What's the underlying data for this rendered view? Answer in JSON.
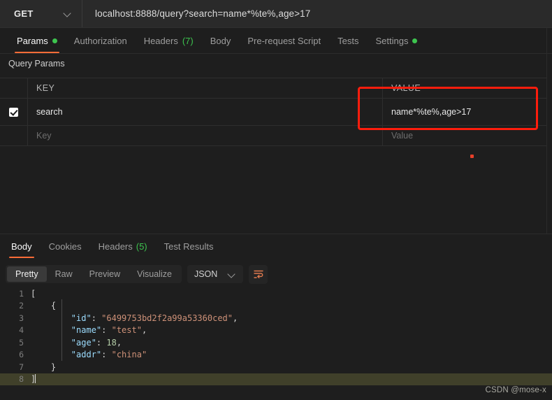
{
  "request": {
    "method": "GET",
    "method_caret_icon": "chevron-down-icon",
    "url": "localhost:8888/query?search=name*%te%,age>17"
  },
  "request_tabs": [
    {
      "label": "Params",
      "badge": "dot",
      "active": true
    },
    {
      "label": "Authorization",
      "badge": "",
      "active": false
    },
    {
      "label": "Headers",
      "badge": "(7)",
      "active": false
    },
    {
      "label": "Body",
      "badge": "",
      "active": false
    },
    {
      "label": "Pre-request Script",
      "badge": "",
      "active": false
    },
    {
      "label": "Tests",
      "badge": "",
      "active": false
    },
    {
      "label": "Settings",
      "badge": "dot",
      "active": false
    }
  ],
  "query_params": {
    "section_title": "Query Params",
    "columns": {
      "key": "KEY",
      "value": "VALUE"
    },
    "rows": [
      {
        "checked": true,
        "key": "search",
        "value": "name*%te%,age>17"
      }
    ],
    "placeholder_row": {
      "key": "Key",
      "value": "Value"
    }
  },
  "annotation": {
    "color": "#fd1d0d",
    "target": "value-cell-highlight"
  },
  "response_tabs": [
    {
      "label": "Body",
      "badge": "",
      "active": true
    },
    {
      "label": "Cookies",
      "badge": "",
      "active": false
    },
    {
      "label": "Headers",
      "badge": "(5)",
      "active": false
    },
    {
      "label": "Test Results",
      "badge": "",
      "active": false
    }
  ],
  "view_bar": {
    "segments": [
      {
        "label": "Pretty",
        "active": true
      },
      {
        "label": "Raw",
        "active": false
      },
      {
        "label": "Preview",
        "active": false
      },
      {
        "label": "Visualize",
        "active": false
      }
    ],
    "format": "JSON",
    "format_caret_icon": "chevron-down-icon",
    "wrap_icon": "word-wrap-icon"
  },
  "response_body": {
    "lines": [
      {
        "num": "1",
        "segments": [
          {
            "t": "[",
            "c": "punct"
          }
        ],
        "highlight": false,
        "caret": false
      },
      {
        "num": "2",
        "segments": [
          {
            "t": "    {",
            "c": "punct"
          }
        ],
        "highlight": false,
        "caret": false
      },
      {
        "num": "3",
        "segments": [
          {
            "t": "        ",
            "c": "punct"
          },
          {
            "t": "\"id\"",
            "c": "key"
          },
          {
            "t": ": ",
            "c": "punct"
          },
          {
            "t": "\"6499753bd2f2a99a53360ced\"",
            "c": "str"
          },
          {
            "t": ",",
            "c": "punct"
          }
        ],
        "highlight": false,
        "caret": false
      },
      {
        "num": "4",
        "segments": [
          {
            "t": "        ",
            "c": "punct"
          },
          {
            "t": "\"name\"",
            "c": "key"
          },
          {
            "t": ": ",
            "c": "punct"
          },
          {
            "t": "\"test\"",
            "c": "str"
          },
          {
            "t": ",",
            "c": "punct"
          }
        ],
        "highlight": false,
        "caret": false
      },
      {
        "num": "5",
        "segments": [
          {
            "t": "        ",
            "c": "punct"
          },
          {
            "t": "\"age\"",
            "c": "key"
          },
          {
            "t": ": ",
            "c": "punct"
          },
          {
            "t": "18",
            "c": "num"
          },
          {
            "t": ",",
            "c": "punct"
          }
        ],
        "highlight": false,
        "caret": false
      },
      {
        "num": "6",
        "segments": [
          {
            "t": "        ",
            "c": "punct"
          },
          {
            "t": "\"addr\"",
            "c": "key"
          },
          {
            "t": ": ",
            "c": "punct"
          },
          {
            "t": "\"china\"",
            "c": "str"
          }
        ],
        "highlight": false,
        "caret": false
      },
      {
        "num": "7",
        "segments": [
          {
            "t": "    }",
            "c": "punct"
          }
        ],
        "highlight": false,
        "caret": false
      },
      {
        "num": "8",
        "segments": [
          {
            "t": "]",
            "c": "punct"
          }
        ],
        "highlight": true,
        "caret": true
      }
    ]
  },
  "watermark": "CSDN @mose-x",
  "colors": {
    "accent": "#ff6c37",
    "green": "#3dc44f",
    "annotation_red": "#fd1d0d",
    "background": "#1e1e1e",
    "panel": "#2a2a2a"
  }
}
